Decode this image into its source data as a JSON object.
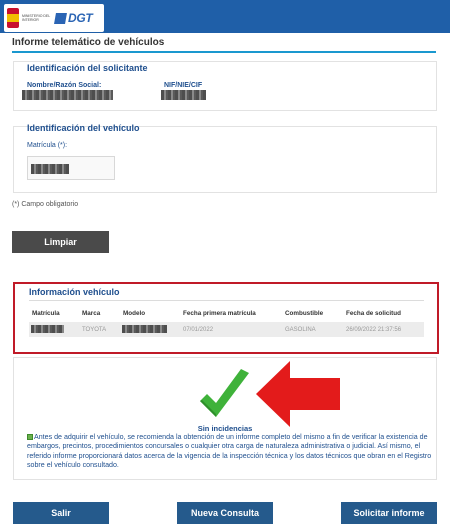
{
  "header": {
    "ministry_text": "MINISTERIO DEL INTERIOR",
    "dgt_text": "DGT"
  },
  "page": {
    "title": "Informe telemático de vehículos"
  },
  "solicitante": {
    "title": "Identificación del solicitante",
    "name_label": "Nombre/Razón Social:",
    "nif_label": "NIF/NIE/CIF"
  },
  "vehiculo": {
    "title": "Identificación del vehículo",
    "matricula_label": "Matrícula (*):"
  },
  "note": "(*) Campo obligatorio",
  "buttons": {
    "limpiar": "Limpiar",
    "salir": "Salir",
    "nueva_consulta": "Nueva Consulta",
    "solicitar": "Solicitar informe"
  },
  "info_vehiculo": {
    "title": "Información vehículo",
    "headers": [
      "Matrícula",
      "Marca",
      "Modelo",
      "Fecha primera matrícula",
      "Combustible",
      "Fecha de solicitud"
    ],
    "row": {
      "marca": "TOYOTA",
      "fecha_primera": "07/01/2022",
      "combustible": "GASOLINA",
      "fecha_solicitud": "26/09/2022 21:37:56"
    }
  },
  "result": {
    "status": "Sin incidencias",
    "advice": "Antes de adquirir el vehículo, se recomienda la obtención de un informe completo del mismo a fin de verificar la existencia de embargos, precintos, procedimientos concursales o cualquier otra carga de naturaleza administrativa o judicial. Así mismo, el referido informe proporcionará datos acerca de la vigencia de la inspección técnica y los datos técnicos que obran en el Registro sobre el vehículo consultado."
  },
  "colors": {
    "header_blue": "#1f5fa8",
    "accent_cyan": "#1a98cf",
    "highlight_red": "#c01a28",
    "check_green": "#3fb23a",
    "arrow_red": "#e31b1b"
  }
}
